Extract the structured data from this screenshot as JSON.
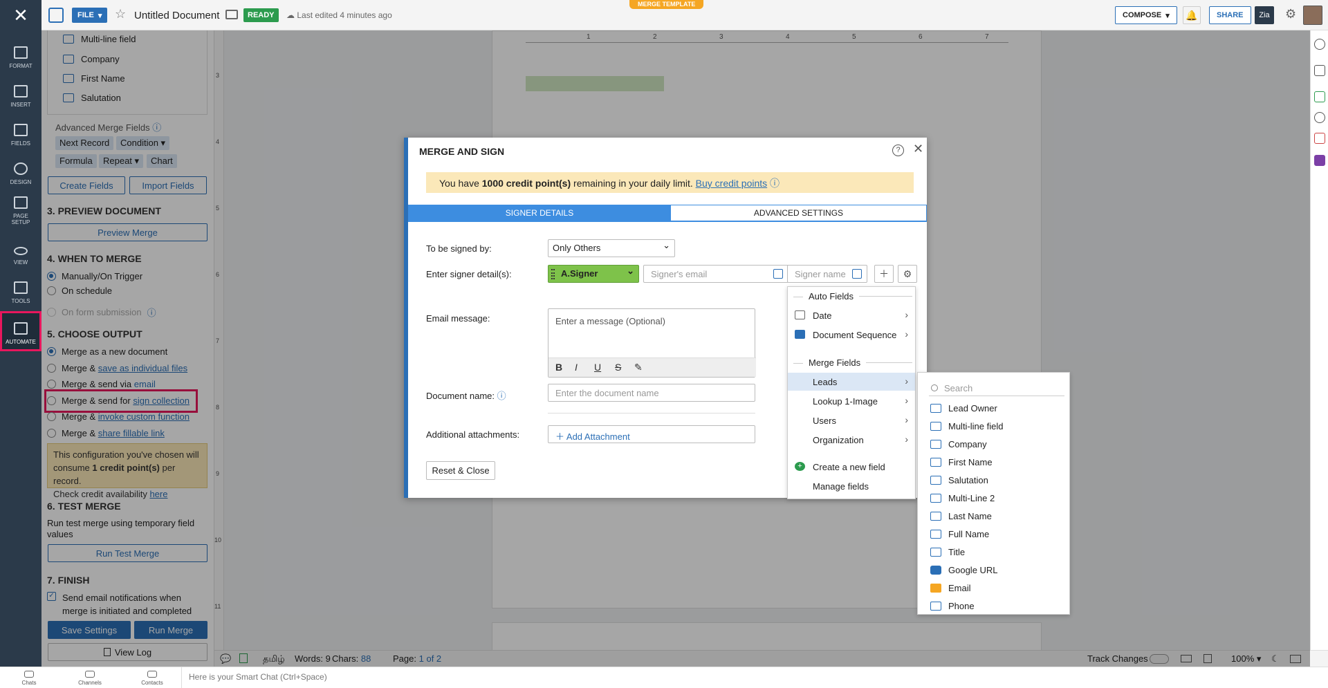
{
  "topbar": {
    "file_label": "FILE",
    "doc_title": "Untitled Document",
    "status": "READY",
    "last_edited": "Last edited 4 minutes ago",
    "template_badge": "MERGE TEMPLATE",
    "compose_label": "COMPOSE",
    "share_label": "SHARE",
    "zia_label": "Zia"
  },
  "rail": {
    "format": "FORMAT",
    "insert": "INSERT",
    "fields": "FIELDS",
    "design": "DESIGN",
    "page_setup": "PAGE SETUP",
    "view": "VIEW",
    "tools": "TOOLS",
    "automate": "AUTOMATE"
  },
  "panel": {
    "fields": [
      "Multi-line field",
      "Company",
      "First Name",
      "Salutation"
    ],
    "advanced_title": "Advanced Merge Fields",
    "adv_chips": {
      "next_record": "Next Record",
      "condition": "Condition",
      "formula": "Formula",
      "repeat": "Repeat",
      "chart": "Chart"
    },
    "create_fields": "Create Fields",
    "import_fields": "Import Fields",
    "preview_title": "3. PREVIEW DOCUMENT",
    "preview_merge": "Preview Merge",
    "when_title": "4. WHEN TO MERGE",
    "when_options": [
      "Manually/On Trigger",
      "On schedule",
      "On form submission"
    ],
    "output_title": "5. CHOOSE OUTPUT",
    "output_new_doc": "Merge as a new document",
    "merge_and": "Merge & ",
    "merge_and_send_for": "Merge & send for ",
    "merge_and_send_via": "Merge & send via ",
    "links": {
      "individual_files": "save as individual files",
      "email": "email",
      "sign_collection": "sign collection",
      "custom_function": "invoke custom function",
      "fillable_link": "share fillable link"
    },
    "warn_line1": "This configuration you've chosen will",
    "warn_line2_a": "consume ",
    "warn_line2_bold": "1 credit point(s)",
    "warn_line2_b": " per record.",
    "warn_line3": "Check credit availability ",
    "warn_link": "here",
    "test_title": "6. TEST MERGE",
    "test_desc": "Run test merge using temporary field values",
    "run_test": "Run Test Merge",
    "finish_title": "7. FINISH",
    "notify_text": "Send email notifications when merge is initiated and completed",
    "save_settings": "Save Settings",
    "run_merge": "Run Merge",
    "view_log": "View Log"
  },
  "ruler": {
    "h_marks": [
      "1",
      "2",
      "3",
      "4",
      "5",
      "6",
      "7"
    ],
    "v_marks": [
      "3",
      "4",
      "5",
      "6",
      "7",
      "8",
      "9",
      "10",
      "11"
    ]
  },
  "dialog": {
    "title": "MERGE AND SIGN",
    "banner_a": "You have ",
    "banner_bold": "1000 credit point(s)",
    "banner_b": " remaining in your daily limit. ",
    "banner_link": "Buy credit points",
    "tab_signer": "SIGNER DETAILS",
    "tab_advanced": "ADVANCED SETTINGS",
    "signed_by_label": "To be signed by:",
    "signed_by_value": "Only Others",
    "signer_label": "Enter signer detail(s):",
    "signer_value": "A.Signer",
    "email_placeholder": "Signer's email",
    "name_placeholder": "Signer name",
    "email_msg_label": "Email message:",
    "msg_placeholder": "Enter a message (Optional)",
    "doc_name_label": "Document name:",
    "doc_name_placeholder": "Enter the document name",
    "attach_label": "Additional attachments:",
    "add_attachment": "Add Attachment",
    "reset_close": "Reset & Close"
  },
  "dropdown": {
    "auto_fields": "Auto Fields",
    "date": "Date",
    "doc_seq": "Document Sequence",
    "merge_fields": "Merge Fields",
    "leads": "Leads",
    "lookup": "Lookup 1-Image",
    "users": "Users",
    "organization": "Organization",
    "create_field": "Create a new field",
    "manage_fields": "Manage fields"
  },
  "submenu": {
    "search_placeholder": "Search",
    "items": [
      "Lead Owner",
      "Multi-line field",
      "Company",
      "First Name",
      "Salutation",
      "Multi-Line 2",
      "Last Name",
      "Full Name",
      "Title",
      "Google URL",
      "Email",
      "Phone"
    ]
  },
  "statusbar": {
    "lang": "தமிழ்",
    "words_label": "Words:",
    "words": "9",
    "chars_label": "Chars:",
    "chars": "88",
    "page_label": "Page:",
    "page": "1",
    "page_of": "of 2",
    "track_changes": "Track Changes",
    "zoom": "100%"
  },
  "bottombar": {
    "chats": "Chats",
    "channels": "Channels",
    "contacts": "Contacts",
    "smart_chat": "Here is your Smart Chat (Ctrl+Space)"
  },
  "colors": {
    "accent": "#2b6fb6",
    "highlight": "#e8175d",
    "rail": "#2b3a4a"
  }
}
